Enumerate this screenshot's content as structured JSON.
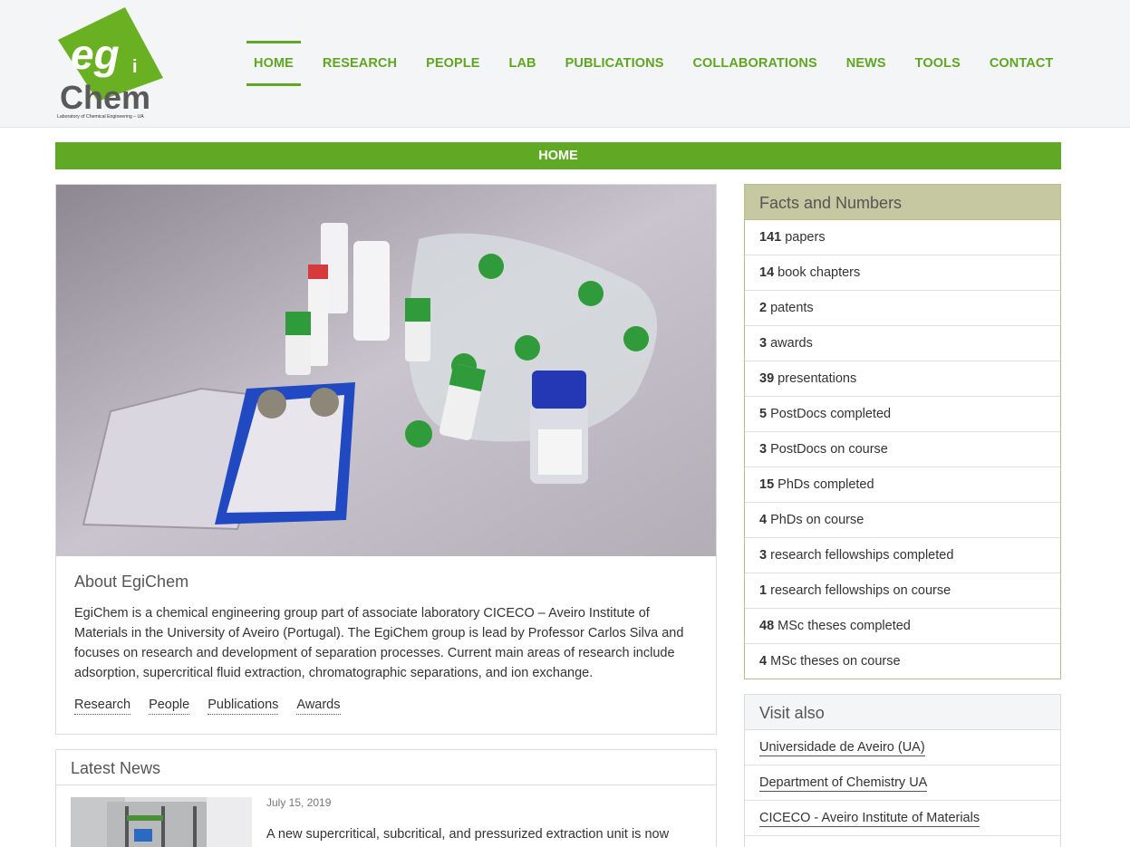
{
  "logo": {
    "main_text": "egiChem",
    "tagline": "Laboratory of Chemical Engineering – UA"
  },
  "nav": {
    "items": [
      {
        "label": "HOME"
      },
      {
        "label": "RESEARCH"
      },
      {
        "label": "PEOPLE"
      },
      {
        "label": "LAB"
      },
      {
        "label": "PUBLICATIONS"
      },
      {
        "label": "COLLABORATIONS"
      },
      {
        "label": "NEWS"
      },
      {
        "label": "TOOLS"
      },
      {
        "label": "CONTACT"
      }
    ],
    "active": "HOME"
  },
  "page_title": "HOME",
  "about": {
    "title": "About EgiChem",
    "text": "EgiChem is a chemical engineering group part of associate laboratory CICECO – Aveiro Institute of Materials in the University of Aveiro (Portugal). The EgiChem group is lead by Professor Carlos Silva and focuses on research and development of separation processes. Current main areas of research include adsorption, supercritical fluid extraction, chromatographic separations, and ion exchange.",
    "links": [
      {
        "label": "Research"
      },
      {
        "label": "People"
      },
      {
        "label": "Publications"
      },
      {
        "label": "Awards"
      }
    ]
  },
  "latest_news": {
    "title": "Latest News",
    "item": {
      "date": "July 15, 2019",
      "text": "A new supercritical, subcritical, and pressurized extraction unit is now"
    }
  },
  "facts": {
    "title": "Facts and Numbers",
    "rows": [
      {
        "number": "141",
        "label": "papers"
      },
      {
        "number": "14",
        "label": "book chapters"
      },
      {
        "number": "2",
        "label": "patents"
      },
      {
        "number": "3",
        "label": "awards"
      },
      {
        "number": "39",
        "label": "presentations"
      },
      {
        "number": "5",
        "label": "PostDocs completed"
      },
      {
        "number": "3",
        "label": "PostDocs on course"
      },
      {
        "number": "15",
        "label": "PhDs completed"
      },
      {
        "number": "4",
        "label": "PhDs on course"
      },
      {
        "number": "3",
        "label": "research fellowships completed"
      },
      {
        "number": "1",
        "label": "research fellowships on course"
      },
      {
        "number": "48",
        "label": "MSc theses completed"
      },
      {
        "number": "4",
        "label": "MSc theses on course"
      }
    ]
  },
  "visit_also": {
    "title": "Visit also",
    "links": [
      {
        "label": "Universidade de Aveiro (UA)"
      },
      {
        "label": "Department of Chemistry UA"
      },
      {
        "label": "CICECO - Aveiro Institute of Materials"
      }
    ]
  },
  "colors": {
    "brand_green": "#60a925",
    "facts_header": "#c5c8a0",
    "facts_border": "#b9be8e"
  }
}
